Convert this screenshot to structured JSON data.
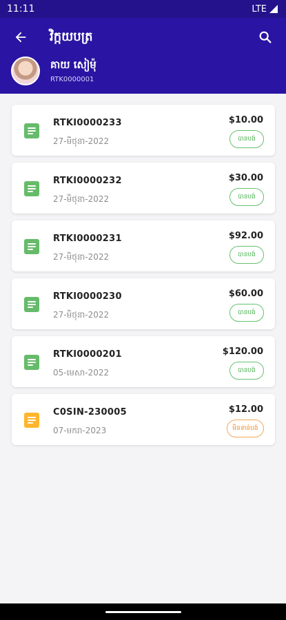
{
  "status": {
    "time": "11:11",
    "network": "LTE"
  },
  "header": {
    "title": "វិក្កយបត្រ",
    "user_name": "គាយ សៀម៉ុ",
    "user_id": "RTK0000001"
  },
  "invoices": [
    {
      "number": "RTKI0000233",
      "date": "27-មិថុនា-2022",
      "amount": "$10.00",
      "status": "បានបង់",
      "icon_color": "#66bb6a",
      "badge": "green"
    },
    {
      "number": "RTKI0000232",
      "date": "27-មិថុនា-2022",
      "amount": "$30.00",
      "status": "បានបង់",
      "icon_color": "#66bb6a",
      "badge": "green"
    },
    {
      "number": "RTKI0000231",
      "date": "27-មិថុនា-2022",
      "amount": "$92.00",
      "status": "បានបង់",
      "icon_color": "#66bb6a",
      "badge": "green"
    },
    {
      "number": "RTKI0000230",
      "date": "27-មិថុនា-2022",
      "amount": "$60.00",
      "status": "បានបង់",
      "icon_color": "#66bb6a",
      "badge": "green"
    },
    {
      "number": "RTKI0000201",
      "date": "05-មេសា-2022",
      "amount": "$120.00",
      "status": "បានបង់",
      "icon_color": "#66bb6a",
      "badge": "green"
    },
    {
      "number": "C0SIN-230005",
      "date": "07-មករា-2023",
      "amount": "$12.00",
      "status": "មិនទាន់បង់",
      "icon_color": "#ffb62e",
      "badge": "orange"
    }
  ]
}
